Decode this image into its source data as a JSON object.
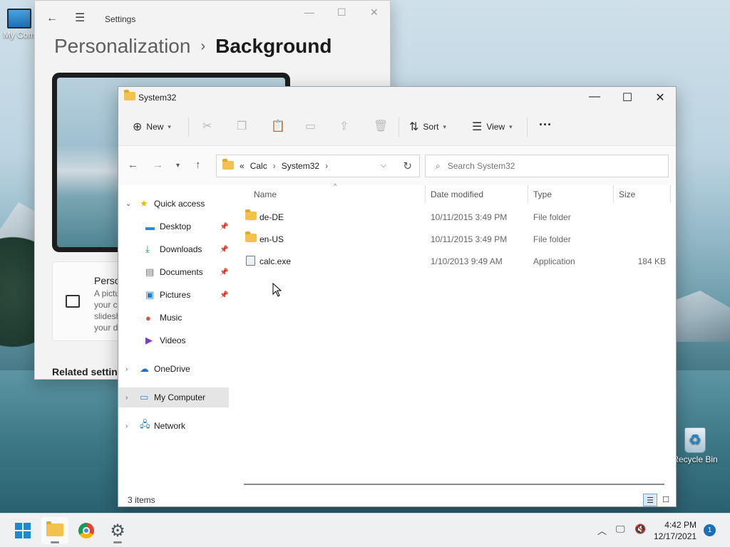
{
  "desktop": {
    "icons": [
      {
        "label": "My Com"
      },
      {
        "label": "Recycle Bin"
      }
    ]
  },
  "settings": {
    "title": "Settings",
    "breadcrumb": {
      "parent": "Personalization",
      "current": "Background"
    },
    "card": {
      "title": "Perso",
      "desc": "A pictu your c slidesh your d"
    },
    "related": "Related setting"
  },
  "explorer": {
    "title": "System32",
    "toolbar": {
      "new_label": "New",
      "sort_label": "Sort",
      "view_label": "View",
      "more": "···"
    },
    "address": {
      "prefix": "«",
      "segments": [
        "Calc",
        "System32"
      ]
    },
    "search": {
      "placeholder": "Search System32"
    },
    "nav": {
      "quick_access": "Quick access",
      "items": [
        {
          "label": "Desktop",
          "pinned": true
        },
        {
          "label": "Downloads",
          "pinned": true
        },
        {
          "label": "Documents",
          "pinned": true
        },
        {
          "label": "Pictures",
          "pinned": true
        },
        {
          "label": "Music",
          "pinned": false
        },
        {
          "label": "Videos",
          "pinned": false
        }
      ],
      "onedrive": "OneDrive",
      "my_computer": "My Computer",
      "network": "Network"
    },
    "columns": {
      "name": "Name",
      "date": "Date modified",
      "type": "Type",
      "size": "Size"
    },
    "files": [
      {
        "name": "de-DE",
        "date": "10/11/2015 3:49 PM",
        "type": "File folder",
        "size": "",
        "kind": "folder"
      },
      {
        "name": "en-US",
        "date": "10/11/2015 3:49 PM",
        "type": "File folder",
        "size": "",
        "kind": "folder"
      },
      {
        "name": "calc.exe",
        "date": "1/10/2013 9:49 AM",
        "type": "Application",
        "size": "184 KB",
        "kind": "app"
      }
    ],
    "status": {
      "count": "3 items"
    }
  },
  "taskbar": {
    "time": "4:42 PM",
    "date": "12/17/2021",
    "notifications": "1"
  },
  "colors": {
    "accent": "#1a8ad4",
    "folder": "#f2c14e"
  }
}
